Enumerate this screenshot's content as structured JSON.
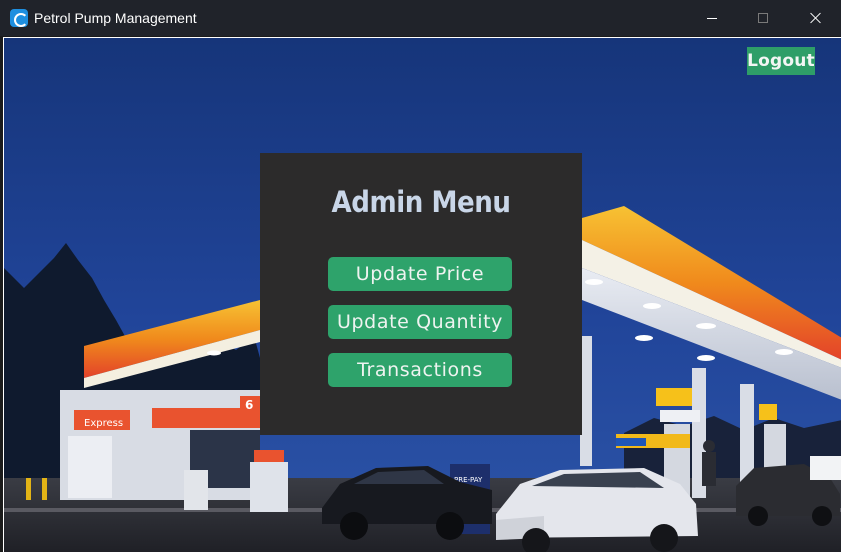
{
  "window": {
    "title": "Petrol Pump Management"
  },
  "header": {
    "logout_label": "Logout"
  },
  "admin_menu": {
    "title": "Admin Menu",
    "buttons": [
      {
        "label": "Update Price"
      },
      {
        "label": "Update Quantity"
      },
      {
        "label": "Transactions"
      }
    ]
  },
  "background": {
    "sign_text": "Express",
    "pump_sign": "PRE-PAY",
    "price_digit": "6"
  },
  "colors": {
    "accent_green": "#2ea36b",
    "panel": "#2c2b2b",
    "sky": "#1c3d86",
    "canopy_red": "#e3422a",
    "canopy_yellow": "#f5b11a"
  }
}
